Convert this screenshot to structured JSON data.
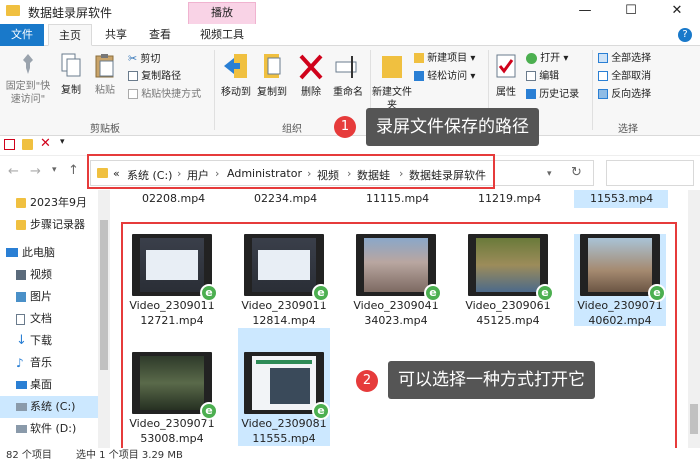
{
  "window": {
    "title": "数据蛙录屏软件",
    "context_tab": "播放",
    "min_glyph": "—",
    "max_glyph": "☐",
    "close_glyph": "✕"
  },
  "tabs": [
    "文件",
    "主页",
    "共享",
    "查看",
    "视频工具"
  ],
  "ribbon": {
    "pin_label": "固定到\"快速访问\"",
    "copy_label": "复制",
    "paste_label": "粘贴",
    "cut_label": "剪切",
    "copy_path_label": "复制路径",
    "paste_shortcut_label": "粘贴快捷方式",
    "clipboard_group": "剪贴板",
    "move_to_label": "移动到",
    "copy_to_label": "复制到",
    "delete_label": "删除",
    "rename_label": "重命名",
    "organize_group": "组织",
    "new_folder_label": "新建文件夹",
    "new_item_label": "新建项目",
    "easy_access_label": "轻松访问",
    "properties_label": "属性",
    "open_label": "打开",
    "edit_label": "编辑",
    "history_label": "历史记录",
    "select_all_label": "全部选择",
    "select_none_label": "全部取消",
    "invert_label": "反向选择",
    "select_group": "选择"
  },
  "address": {
    "prefix": "«",
    "crumbs": [
      "系统 (C:)",
      "用户",
      "Administrator",
      "视频",
      "数据蛙",
      "数据蛙录屏软件"
    ]
  },
  "nav_pane": {
    "items": [
      "2023年9月",
      "步骤记录器",
      "此电脑",
      "视频",
      "图片",
      "文档",
      "下载",
      "音乐",
      "桌面",
      "系统 (C:)",
      "软件 (D:)"
    ]
  },
  "files": {
    "partial_row": [
      "02208.mp4",
      "02234.mp4",
      "11115.mp4",
      "11219.mp4",
      "11553.mp4"
    ],
    "items": [
      {
        "line1": "Video_2309011",
        "line2": "12721.mp4"
      },
      {
        "line1": "Video_2309011",
        "line2": "12814.mp4"
      },
      {
        "line1": "Video_2309041",
        "line2": "34023.mp4"
      },
      {
        "line1": "Video_2309061",
        "line2": "45125.mp4"
      },
      {
        "line1": "Video_2309071",
        "line2": "40602.mp4"
      },
      {
        "line1": "Video_2309071",
        "line2": "53008.mp4"
      },
      {
        "line1": "Video_2309081",
        "line2": "11555.mp4"
      }
    ]
  },
  "annotations": {
    "badge1": "1",
    "callout1": "录屏文件保存的路径",
    "badge2": "2",
    "callout2": "可以选择一种方式打开它"
  },
  "status": {
    "count": "82 个项目",
    "selection": "选中 1 个项目  3.29 MB"
  },
  "colors": {
    "accent": "#1979ca",
    "annotation_red": "#e63b3b",
    "callout_bg": "#555555",
    "selection": "#cce8ff",
    "context_tab": "#f9d3e6"
  }
}
